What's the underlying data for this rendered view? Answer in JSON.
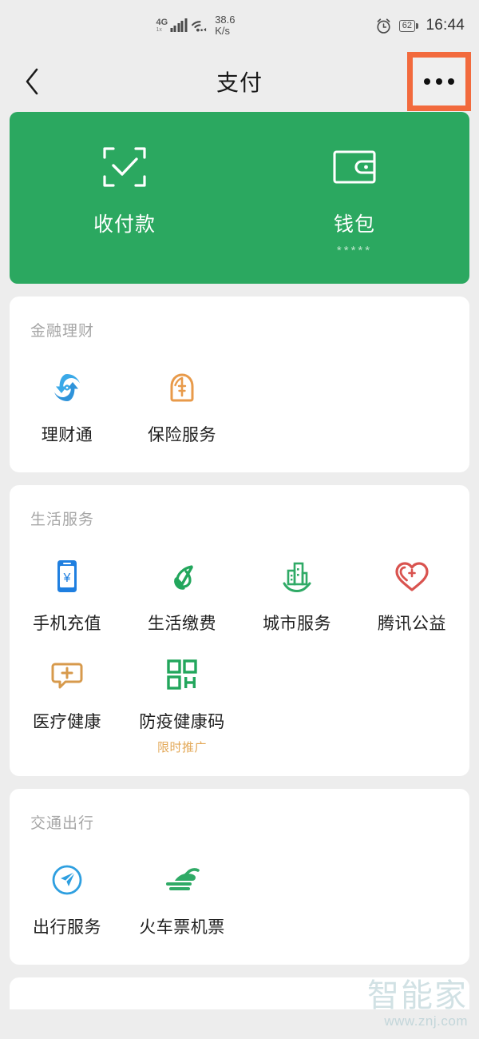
{
  "status_bar": {
    "network_type": "4G",
    "network_sub": "1x",
    "speed_value": "38.6",
    "speed_unit": "K/s",
    "alarm_icon": "alarm-clock-icon",
    "battery_level": "62",
    "time": "16:44"
  },
  "nav": {
    "back_icon": "chevron-left-icon",
    "title": "支付",
    "more_icon": "more-options-icon",
    "highlight_color": "#f26a3d"
  },
  "top_card": {
    "background_color": "#2BA860",
    "items": [
      {
        "icon": "scan-qr-icon",
        "label": "收付款",
        "sub": ""
      },
      {
        "icon": "wallet-icon",
        "label": "钱包",
        "sub": "*****"
      }
    ]
  },
  "sections": [
    {
      "title": "金融理财",
      "items": [
        {
          "icon": "licaitong-icon",
          "label": "理财通",
          "badge": "",
          "color": "#2e9fe0"
        },
        {
          "icon": "insurance-icon",
          "label": "保险服务",
          "badge": "",
          "color": "#e89a4a"
        }
      ]
    },
    {
      "title": "生活服务",
      "items": [
        {
          "icon": "mobile-recharge-icon",
          "label": "手机充值",
          "badge": "",
          "color": "#1f7fe0"
        },
        {
          "icon": "utility-payment-icon",
          "label": "生活缴费",
          "badge": "",
          "color": "#22a65c"
        },
        {
          "icon": "city-service-icon",
          "label": "城市服务",
          "badge": "",
          "color": "#2faa66"
        },
        {
          "icon": "tencent-charity-icon",
          "label": "腾讯公益",
          "badge": "",
          "color": "#d9534f"
        },
        {
          "icon": "medical-health-icon",
          "label": "医疗健康",
          "badge": "",
          "color": "#d79a4c"
        },
        {
          "icon": "health-code-icon",
          "label": "防疫健康码",
          "badge": "限时推广",
          "color": "#22a65c"
        }
      ]
    },
    {
      "title": "交通出行",
      "items": [
        {
          "icon": "travel-service-icon",
          "label": "出行服务",
          "badge": "",
          "color": "#2e9fe0"
        },
        {
          "icon": "train-flight-ticket-icon",
          "label": "火车票机票",
          "badge": "",
          "color": "#2faa66"
        }
      ]
    }
  ],
  "watermark": {
    "brand": "智能家",
    "url": "www.znj.com"
  }
}
